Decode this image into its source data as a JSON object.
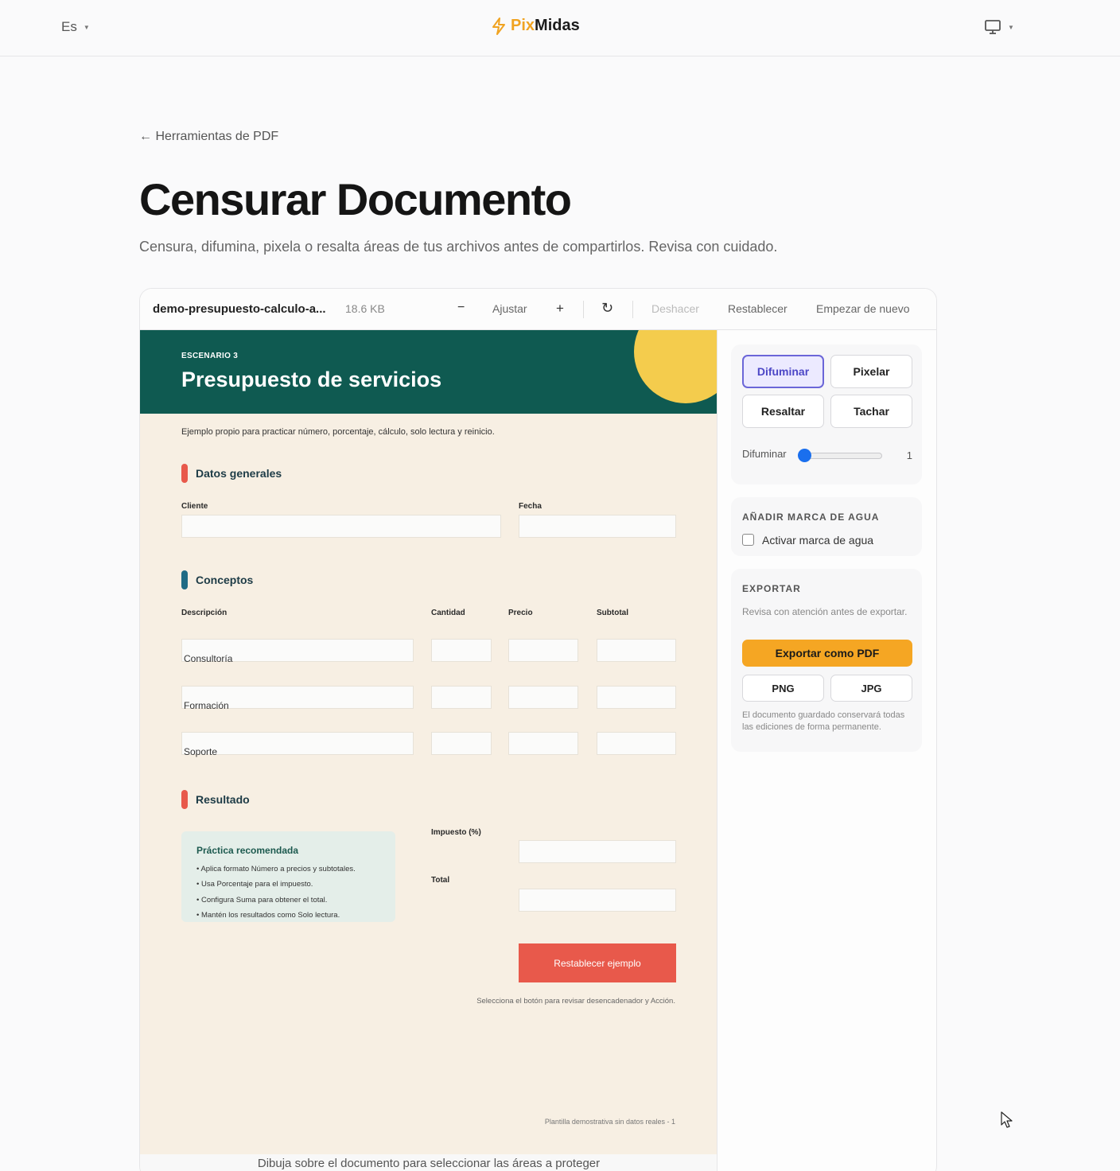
{
  "header": {
    "language": "Es",
    "brand_pix": "Pix",
    "brand_midas": "Midas",
    "brand_accent": "#f0a321",
    "icons": [
      "bolt-icon",
      "monitor-icon"
    ]
  },
  "page": {
    "back_link": "← Herramientas de PDF",
    "title": "Censurar Documento",
    "subtitle": "Censura, difumina, pixela o resalta áreas de tus archivos antes de compartirlos. Revisa con cuidado."
  },
  "toolbar": {
    "filename": "demo-presupuesto-calculo-a...",
    "filesize": "18.6 KB",
    "zoom_out": "−",
    "fit": "Ajustar",
    "zoom_in": "+",
    "rotate": "↻",
    "undo": "Deshacer",
    "reset": "Restablecer",
    "start_over": "Empezar de nuevo"
  },
  "document": {
    "scenario": "ESCENARIO 3",
    "title": "Presupuesto de servicios",
    "intro": "Ejemplo propio para practicar número, porcentaje, cálculo, solo lectura y reinicio.",
    "header_color": "#0f5a51",
    "sections": {
      "general": "Datos generales",
      "concepts": "Conceptos",
      "result": "Resultado"
    },
    "labels": {
      "client": "Cliente",
      "date": "Fecha",
      "description": "Descripción",
      "quantity": "Cantidad",
      "price": "Precio",
      "subtotal": "Subtotal",
      "tax": "Impuesto (%)",
      "total": "Total"
    },
    "rows": [
      "Consultoría",
      "Formación",
      "Soporte"
    ],
    "tip": {
      "title": "Práctica recomendada",
      "items": [
        "• Aplica formato Número a precios y subtotales.",
        "• Usa Porcentaje para el impuesto.",
        "• Configura Suma para obtener el total.",
        "• Mantén los resultados como Solo lectura."
      ]
    },
    "reset_button": "Restablecer ejemplo",
    "note": "Selecciona el botón para revisar desencadenador y Acción.",
    "footer": "Plantilla demostrativa sin datos reales - 1",
    "draw_hint": "Dibuja sobre el documento para seleccionar las áreas a proteger"
  },
  "panel": {
    "modes": [
      "Difuminar",
      "Pixelar",
      "Resaltar",
      "Tachar"
    ],
    "active_mode": "Difuminar",
    "slider_label": "Difuminar",
    "slider_value": "1",
    "watermark_title": "AÑADIR MARCA DE AGUA",
    "watermark_checkbox": "Activar marca de agua",
    "watermark_checked": false,
    "export_title": "EXPORTAR",
    "export_hint": "Revisa con atención antes de exportar.",
    "export_pdf": "Exportar como PDF",
    "export_png": "PNG",
    "export_jpg": "JPG",
    "export_note": "El documento guardado conservará todas las ediciones de forma permanente.",
    "accent": "#f5a623"
  }
}
